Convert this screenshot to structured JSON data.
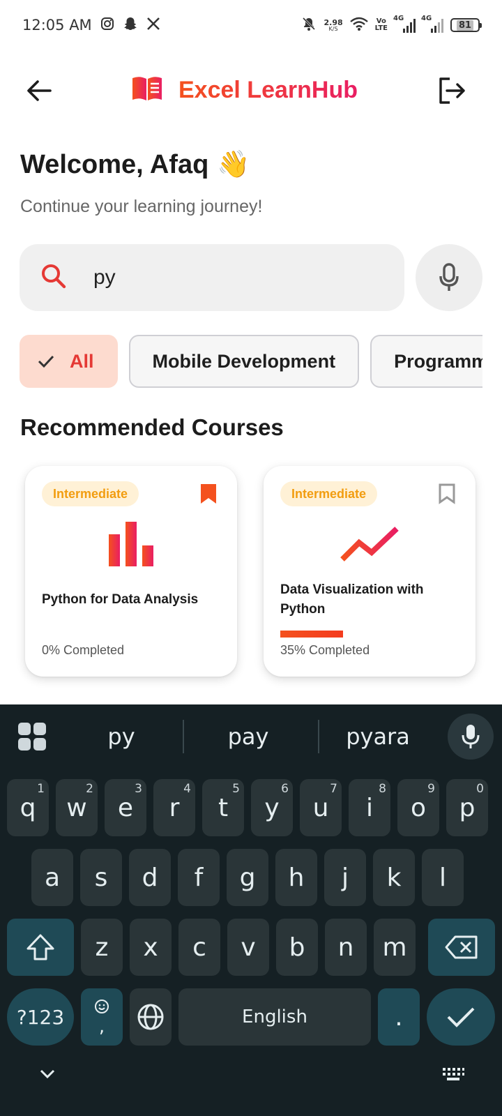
{
  "status_bar": {
    "time": "12:05 AM",
    "net_speed_value": "2.98",
    "net_speed_unit": "K/S",
    "volte_top": "Vo",
    "volte_bottom": "LTE",
    "sim1_label": "4G",
    "sim2_label": "4G",
    "battery": "81"
  },
  "header": {
    "title": "Excel LearnHub"
  },
  "welcome": {
    "greeting": "Welcome, Afaq",
    "emoji": "👋",
    "subtitle": "Continue your learning journey!"
  },
  "search": {
    "value": "py"
  },
  "chips": [
    {
      "label": "All",
      "selected": true
    },
    {
      "label": "Mobile Development",
      "selected": false
    },
    {
      "label": "Programming",
      "selected": false
    }
  ],
  "section_title": "Recommended Courses",
  "courses": [
    {
      "level": "Intermediate",
      "title": "Python for Data Analysis",
      "progress_text": "0% Completed",
      "progress": 0,
      "bookmarked": true,
      "icon": "bar-chart-icon"
    },
    {
      "level": "Intermediate",
      "title": "Data Visualization with Python",
      "progress_text": "35% Completed",
      "progress": 35,
      "bookmarked": false,
      "icon": "trend-line-icon"
    }
  ],
  "keyboard": {
    "suggestions": [
      "py",
      "pay",
      "pyara"
    ],
    "row1": [
      {
        "k": "q",
        "h": "1"
      },
      {
        "k": "w",
        "h": "2"
      },
      {
        "k": "e",
        "h": "3"
      },
      {
        "k": "r",
        "h": "4"
      },
      {
        "k": "t",
        "h": "5"
      },
      {
        "k": "y",
        "h": "6"
      },
      {
        "k": "u",
        "h": "7"
      },
      {
        "k": "i",
        "h": "8"
      },
      {
        "k": "o",
        "h": "9"
      },
      {
        "k": "p",
        "h": "0"
      }
    ],
    "row2": [
      "a",
      "s",
      "d",
      "f",
      "g",
      "h",
      "j",
      "k",
      "l"
    ],
    "row3": [
      "z",
      "x",
      "c",
      "v",
      "b",
      "n",
      "m"
    ],
    "symbols_label": "?123",
    "comma_label": ",",
    "space_label": "English",
    "period_label": "."
  },
  "colors": {
    "brand_start": "#f4511e",
    "brand_end": "#e91e63",
    "chip_active_bg": "#fddbcf",
    "badge_text": "#f29d10",
    "keyboard_bg": "#152024"
  }
}
